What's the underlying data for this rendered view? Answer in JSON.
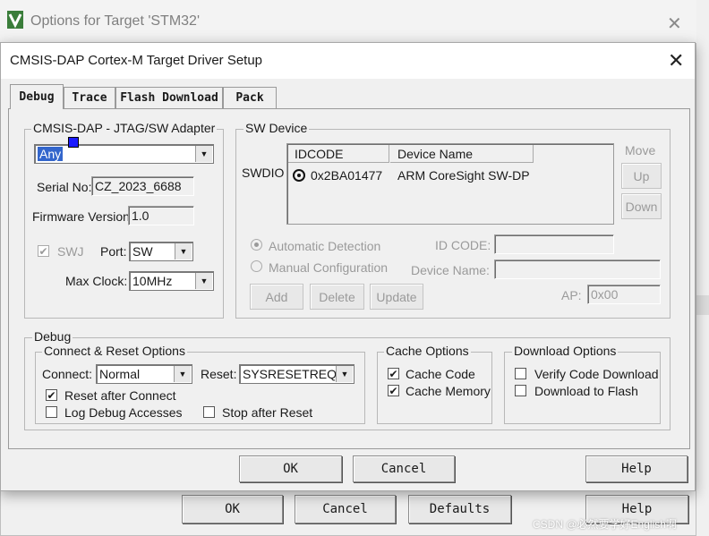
{
  "background_window": {
    "title": "Options for Target 'STM32'",
    "buttons": {
      "ok": "OK",
      "cancel": "Cancel",
      "defaults": "Defaults",
      "help": "Help"
    }
  },
  "dialog": {
    "title": "CMSIS-DAP Cortex-M Target Driver Setup",
    "tabs": [
      {
        "label": "Debug"
      },
      {
        "label": "Trace"
      },
      {
        "label": "Flash Download"
      },
      {
        "label": "Pack"
      }
    ],
    "adapter": {
      "legend": "CMSIS-DAP - JTAG/SW Adapter",
      "selected": "Any",
      "serial_label": "Serial No:",
      "serial_value": "CZ_2023_6688",
      "firmware_label": "Firmware Version:",
      "firmware_value": "1.0",
      "swj_label": "SWJ",
      "port_label": "Port:",
      "port_value": "SW",
      "maxclock_label": "Max Clock:",
      "maxclock_value": "10MHz"
    },
    "sw_device": {
      "legend": "SW Device",
      "row_label": "SWDIO",
      "columns": [
        "IDCODE",
        "Device Name"
      ],
      "rows": [
        {
          "idcode": "0x2BA01477",
          "name": "ARM CoreSight SW-DP"
        }
      ],
      "move_label": "Move",
      "up_label": "Up",
      "down_label": "Down",
      "auto_detect": "Automatic Detection",
      "manual_config": "Manual Configuration",
      "idcode_label": "ID CODE:",
      "device_name_label": "Device Name:",
      "ap_label": "AP:",
      "ap_value": "0x00",
      "add": "Add",
      "delete": "Delete",
      "update": "Update"
    },
    "debug": {
      "legend": "Debug",
      "connect_reset": {
        "legend": "Connect & Reset Options",
        "connect_label": "Connect:",
        "connect_value": "Normal",
        "reset_label": "Reset:",
        "reset_value": "SYSRESETREQ",
        "reset_after_connect": "Reset after Connect",
        "log_debug": "Log Debug Accesses",
        "stop_after_reset": "Stop after Reset"
      },
      "cache": {
        "legend": "Cache Options",
        "code": "Cache Code",
        "memory": "Cache Memory"
      },
      "download": {
        "legend": "Download Options",
        "verify": "Verify Code Download",
        "to_flash": "Download to Flash"
      }
    },
    "buttons": {
      "ok": "OK",
      "cancel": "Cancel",
      "help": "Help"
    }
  },
  "watermark": "CSDN @必然要学好English啊"
}
